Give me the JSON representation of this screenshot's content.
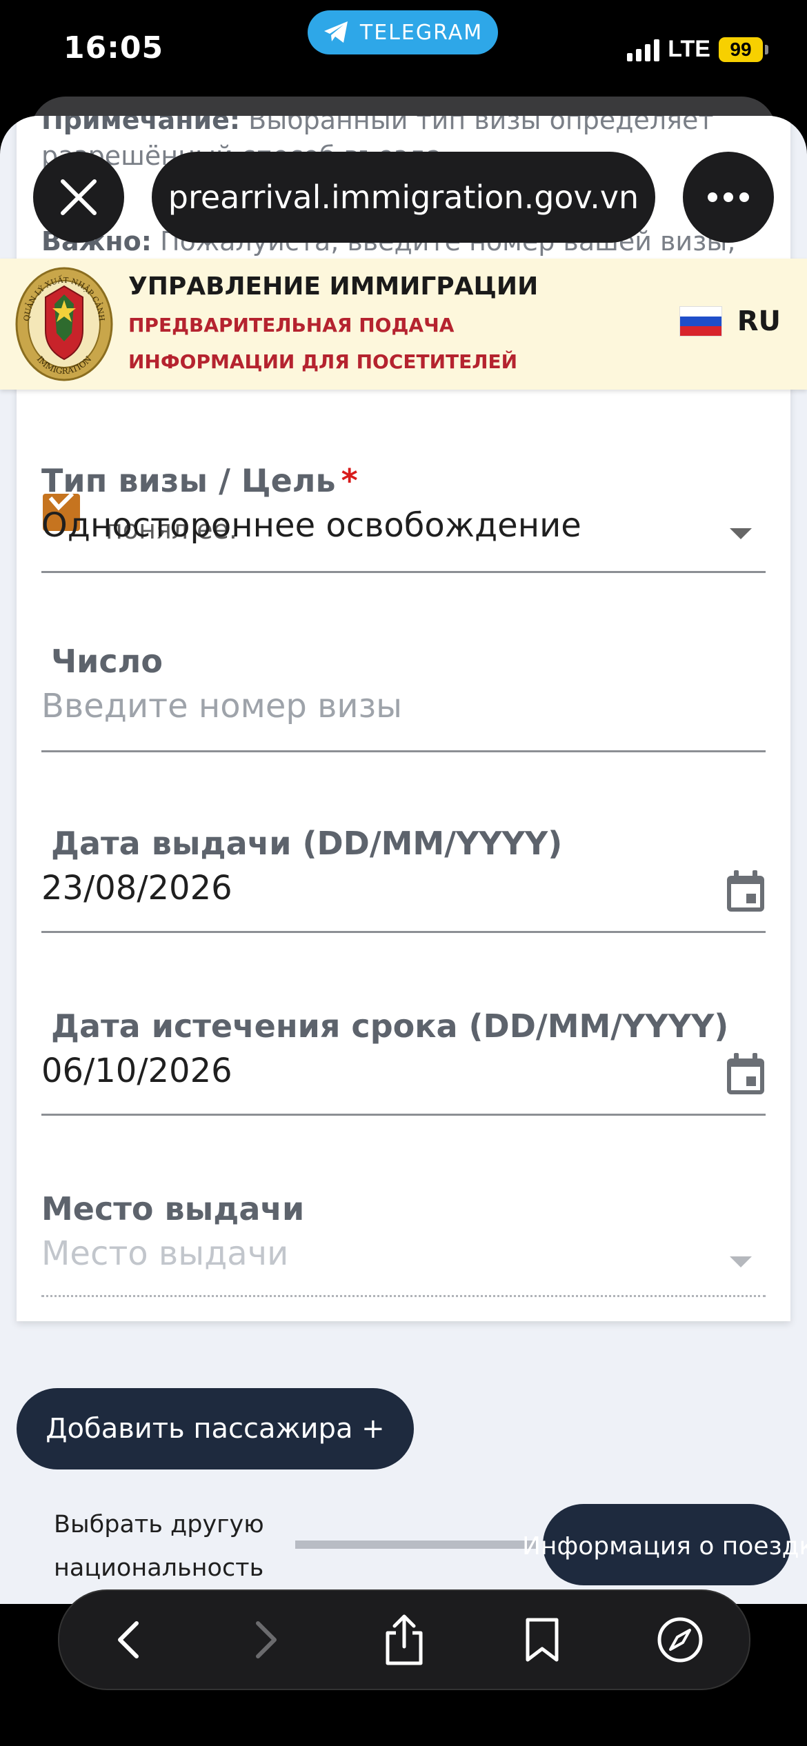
{
  "status_bar": {
    "time": "16:05",
    "telegram_label": "TELEGRAM",
    "network": "LTE",
    "battery": "99"
  },
  "browser": {
    "url": "prearrival.immigration.gov.vn"
  },
  "background_text": {
    "note_label": "Примечание:",
    "note_text": " Выбранный тип визы определяет",
    "note_line2": "разрешённый способ въезда",
    "important_label": "Важно:",
    "important_text": " Пожалуйста, введите номер вашей визы,"
  },
  "header": {
    "title": "УПРАВЛЕНИЕ ИММИГРАЦИИ",
    "subtitle": "ПРЕДВАРИТЕЛЬНАЯ ПОДАЧА ИНФОРМАЦИИ ДЛЯ ПОСЕТИТЕЛЕЙ",
    "language": "RU",
    "emblem_top": "QUẢN LÝ XUẤT NHẬP CẢNH",
    "emblem_bottom": "IMMIGRATION"
  },
  "checkbox": {
    "text": "понял её."
  },
  "form": {
    "visa_type": {
      "label": "Тип визы / Цель",
      "required_mark": "*",
      "value": "Одностороннее освобождение"
    },
    "number": {
      "label": "Число",
      "placeholder": "Введите номер визы"
    },
    "issue_date": {
      "label": "Дата выдачи (DD/MM/YYYY)",
      "value": "23/08/2026"
    },
    "expiry_date": {
      "label": "Дата истечения срока (DD/MM/YYYY)",
      "value": "06/10/2026"
    },
    "place_of_issue": {
      "label": "Место выдачи",
      "placeholder": "Место выдачи"
    }
  },
  "actions": {
    "add_passenger": "Добавить пассажира +",
    "choose_nationality": "Выбрать другую национальность",
    "trip_info": "Информация о поездке"
  },
  "colors": {
    "primary_button": "#1e2a3e",
    "header_background": "#fdf7dc",
    "header_subtitle": "#b5232f",
    "checkbox": "#c6741f",
    "required": "#d81b1b",
    "telegram": "#2ea7e8"
  }
}
